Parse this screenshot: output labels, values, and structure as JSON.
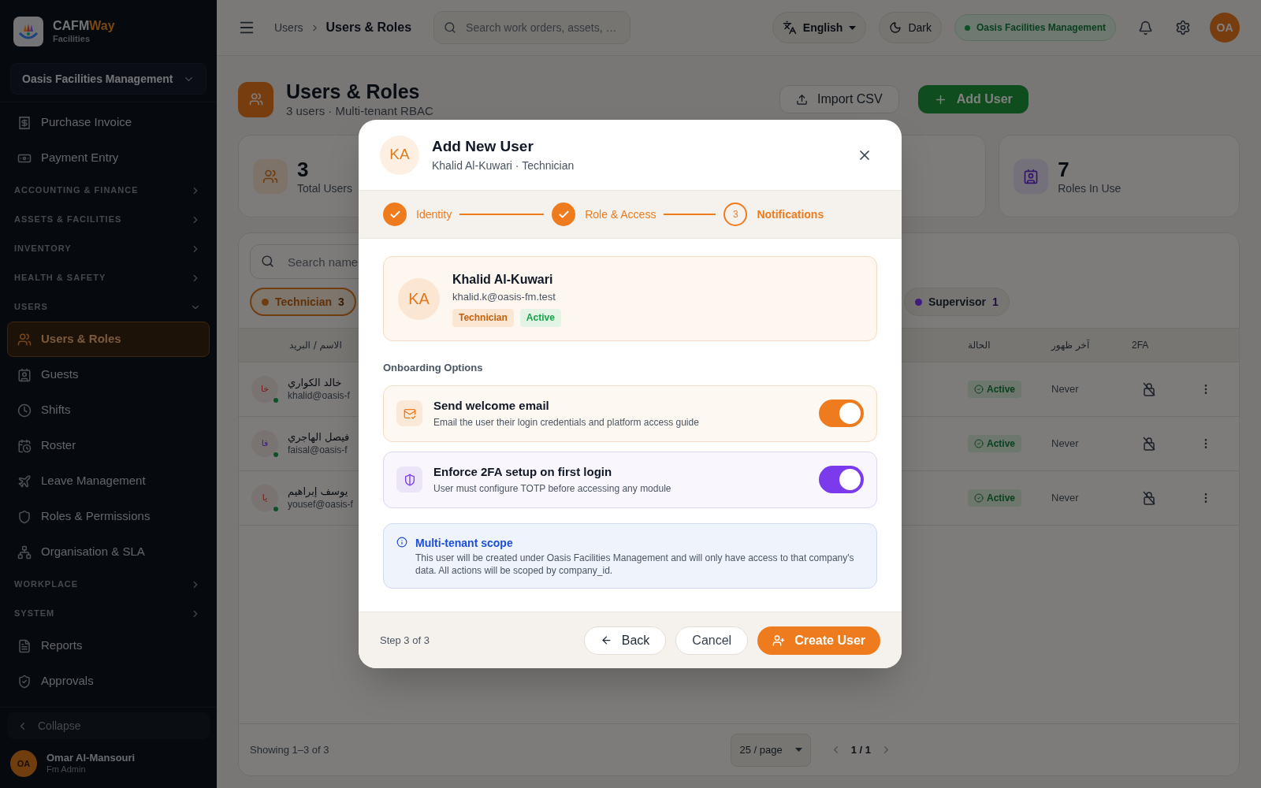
{
  "sidebar": {
    "brand": {
      "name": "CAFM",
      "name_accent": "Way",
      "subtitle": "Facilities"
    },
    "company_selector": "Oasis Facilities Management",
    "nav": [
      {
        "kind": "link",
        "label": "Purchase Invoice",
        "selected": false
      },
      {
        "kind": "link",
        "label": "Payment Entry",
        "selected": false
      },
      {
        "kind": "section",
        "label": "ACCOUNTING & FINANCE",
        "expanded": false
      },
      {
        "kind": "section",
        "label": "ASSETS & FACILITIES",
        "expanded": false
      },
      {
        "kind": "section",
        "label": "INVENTORY",
        "expanded": false
      },
      {
        "kind": "section",
        "label": "HEALTH & SAFETY",
        "expanded": false
      },
      {
        "kind": "section",
        "label": "USERS",
        "expanded": true,
        "children": [
          {
            "kind": "link",
            "label": "Users & Roles",
            "selected": true
          },
          {
            "kind": "link",
            "label": "Guests",
            "selected": false
          },
          {
            "kind": "link",
            "label": "Shifts",
            "selected": false
          },
          {
            "kind": "link",
            "label": "Roster",
            "selected": false
          },
          {
            "kind": "link",
            "label": "Leave Management",
            "selected": false
          },
          {
            "kind": "link",
            "label": "Roles & Permissions",
            "selected": false
          },
          {
            "kind": "link",
            "label": "Organisation & SLA",
            "selected": false
          }
        ]
      },
      {
        "kind": "section",
        "label": "WORKPLACE",
        "expanded": false
      },
      {
        "kind": "section",
        "label": "SYSTEM",
        "expanded": false
      },
      {
        "kind": "link",
        "label": "Reports",
        "selected": false
      },
      {
        "kind": "link",
        "label": "Approvals",
        "selected": false
      }
    ],
    "collapse": "Collapse",
    "user": {
      "initials": "OA",
      "name": "Omar Al-Mansouri",
      "role": "Fm Admin"
    }
  },
  "topbar": {
    "breadcrumb": [
      "Users",
      "Users & Roles"
    ],
    "search": {
      "placeholder": "Search work orders, assets, …"
    },
    "language": "English",
    "theme": "Dark",
    "tenant": "Oasis Facilities Management",
    "avatar": "OA"
  },
  "page": {
    "title": "Users & Roles",
    "subtitle": "3 users · Multi-tenant RBAC",
    "buttons": [
      "Import CSV",
      "Add User"
    ],
    "stats": [
      {
        "value": "3",
        "label": "Total Users"
      },
      {
        "value": "7",
        "label": "Roles In Use"
      }
    ],
    "search": {
      "placeholder": "Search name"
    },
    "filters": [
      {
        "label": "Technician",
        "count": "3",
        "color": "#703d10",
        "selected": true
      },
      {
        "label": "Supervisor",
        "count": "1",
        "color": "#3f1a80",
        "selected": false
      }
    ],
    "table": {
      "columns": {
        "name": "الاسم / البريد",
        "status": "الحالة",
        "last_seen": "آخر ظهور",
        "two_fa": "2FA"
      },
      "rows": [
        {
          "initials": "خا",
          "name": "خالد الكواري",
          "email": "khalid@oasis-f",
          "status": "Active",
          "last_seen": "Never",
          "color": "#7a1818"
        },
        {
          "initials": "فا",
          "name": "فيصل الهاجري",
          "email": "faisal@oasis-f",
          "status": "Active",
          "last_seen": "Never",
          "color": "#44207f"
        },
        {
          "initials": "يا",
          "name": "يوسف إبراهيم",
          "email": "yousef@oasis-f",
          "status": "Active",
          "last_seen": "Never",
          "color": "#7a1818"
        }
      ]
    },
    "footer": {
      "showing": "Showing 1–3 of 3",
      "page_size": "25 / page",
      "pages": "1 / 1"
    }
  },
  "modal": {
    "initials": "KA",
    "title": "Add New User",
    "subtitle": "Khalid Al-Kuwari · Technician",
    "steps": [
      {
        "label": "Identity",
        "done": true,
        "selected": false
      },
      {
        "label": "Role & Access",
        "done": true,
        "selected": false
      },
      {
        "label": "Notifications",
        "number": "3",
        "done": false,
        "selected": true
      }
    ],
    "summary": {
      "initials": "KA",
      "name": "Khalid Al-Kuwari",
      "email": "khalid.k@oasis-fm.test",
      "tags": [
        {
          "label": "Technician",
          "kind": "role"
        },
        {
          "label": "Active",
          "kind": "status"
        }
      ]
    },
    "section_title": "Onboarding Options",
    "options": [
      {
        "title": "Send welcome email",
        "description": "Email the user their login credentials and platform access guide",
        "on": true,
        "color": "#ee7b1e"
      },
      {
        "title": "Enforce 2FA setup on first login",
        "description": "User must configure TOTP before accessing any module",
        "on": true,
        "color": "#7c3aed"
      }
    ],
    "info": {
      "title": "Multi-tenant scope",
      "text": "This user will be created under Oasis Facilities Management and will only have access to that company's data. All actions will be scoped by company_id."
    },
    "footer": {
      "step": "Step 3 of 3",
      "buttons": [
        "Back",
        "Cancel",
        "Create User"
      ]
    }
  }
}
